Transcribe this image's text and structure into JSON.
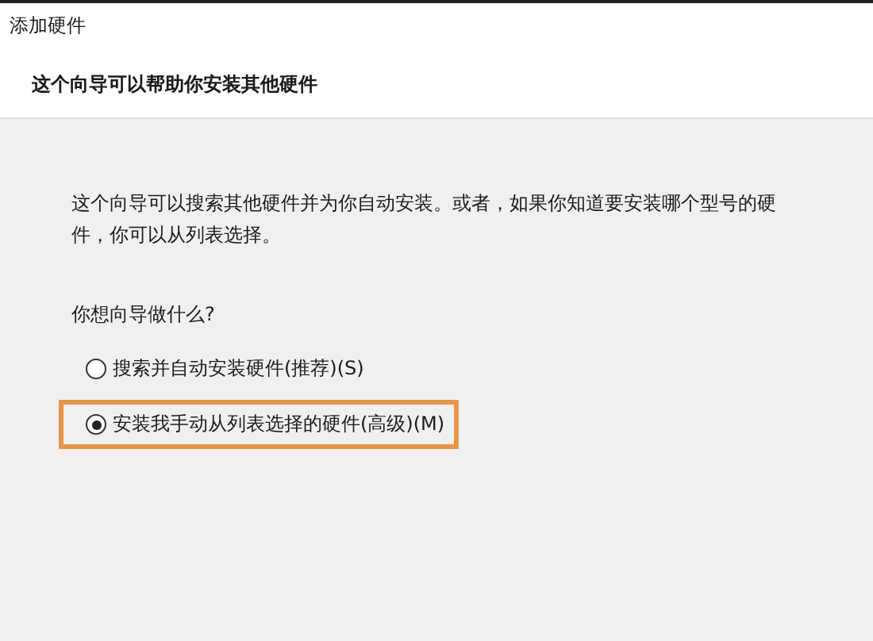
{
  "window": {
    "title": "添加硬件"
  },
  "header": {
    "heading": "这个向导可以帮助你安装其他硬件"
  },
  "body": {
    "description": "这个向导可以搜索其他硬件并为你自动安装。或者，如果你知道要安装哪个型号的硬件，你可以从列表选择。",
    "question": "你想向导做什么?",
    "options": [
      {
        "label": "搜索并自动安装硬件(推荐)(S)",
        "selected": false,
        "highlighted": false
      },
      {
        "label": "安装我手动从列表选择的硬件(高级)(M)",
        "selected": true,
        "highlighted": true
      }
    ]
  }
}
